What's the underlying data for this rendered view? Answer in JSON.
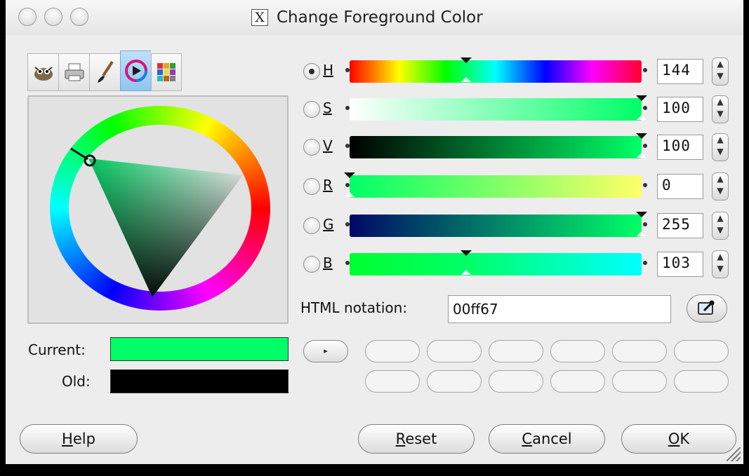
{
  "window": {
    "title": "Change Foreground Color",
    "title_icon_glyph": "X"
  },
  "tabs": [
    {
      "icon": "gimp-icon"
    },
    {
      "icon": "printer-icon"
    },
    {
      "icon": "brush-icon"
    },
    {
      "icon": "color-wheel-icon",
      "active": true
    },
    {
      "icon": "palette-icon"
    }
  ],
  "labels": {
    "current": "Current:",
    "old": "Old:",
    "html_notation": "HTML notation:"
  },
  "colors": {
    "current": "#00ff67",
    "old": "#000000"
  },
  "channels": [
    {
      "letter": "H",
      "value": "144",
      "selected": true,
      "marker_fraction": 0.4
    },
    {
      "letter": "S",
      "value": "100",
      "selected": false,
      "marker_fraction": 1.0
    },
    {
      "letter": "V",
      "value": "100",
      "selected": false,
      "marker_fraction": 1.0
    },
    {
      "letter": "R",
      "value": "0",
      "selected": false,
      "marker_fraction": 0.0
    },
    {
      "letter": "G",
      "value": "255",
      "selected": false,
      "marker_fraction": 1.0
    },
    {
      "letter": "B",
      "value": "103",
      "selected": false,
      "marker_fraction": 0.4
    }
  ],
  "html_value": "00ff67",
  "spin_up": "▲",
  "spin_down": "▼",
  "history_arrow": "▸",
  "buttons": {
    "help": {
      "mnemonic": "H",
      "rest": "elp"
    },
    "reset": {
      "mnemonic": "R",
      "rest": "eset"
    },
    "cancel": {
      "mnemonic": "C",
      "rest": "ancel"
    },
    "ok": {
      "mnemonic": "O",
      "rest": "K"
    }
  }
}
